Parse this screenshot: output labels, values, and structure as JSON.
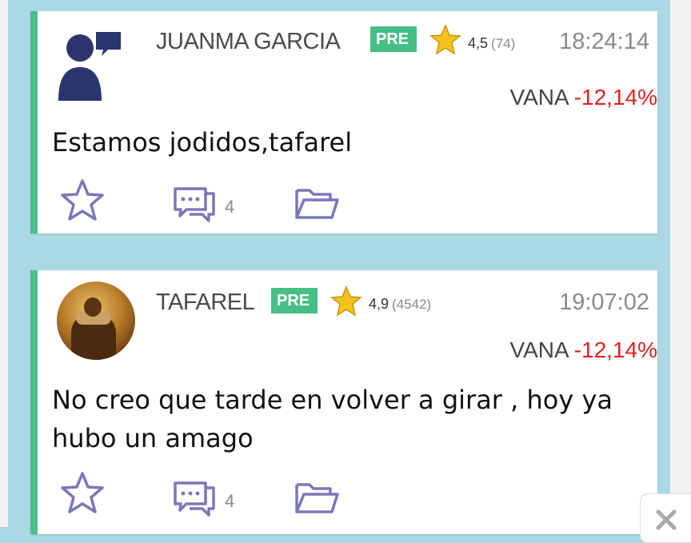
{
  "icons": {
    "favorite": "star-outline-icon",
    "comments": "speech-bubble-icon",
    "save": "folder-icon",
    "rating": "star-filled-icon",
    "close": "close-icon"
  },
  "colors": {
    "background": "#aad8e4",
    "card_accent": "#4bc08a",
    "pre_badge": "#45bf86",
    "negative_change": "#e02020",
    "icon_outline": "#7b78b8"
  },
  "posts": [
    {
      "username": "JUANMA GARCIA",
      "badge": "PRE",
      "rating": "4,5",
      "rating_count": "(74)",
      "time": "18:24:14",
      "ticker": "VANA",
      "change": "-12,14%",
      "message": "Estamos jodidos,tafarel",
      "comment_count": "4"
    },
    {
      "username": "TAFAREL",
      "badge": "PRE",
      "rating": "4,9",
      "rating_count": "(4542)",
      "time": "19:07:02",
      "ticker": "VANA",
      "change": "-12,14%",
      "message": "No creo que tarde en volver a girar , hoy ya hubo un amago",
      "comment_count": "4"
    }
  ]
}
